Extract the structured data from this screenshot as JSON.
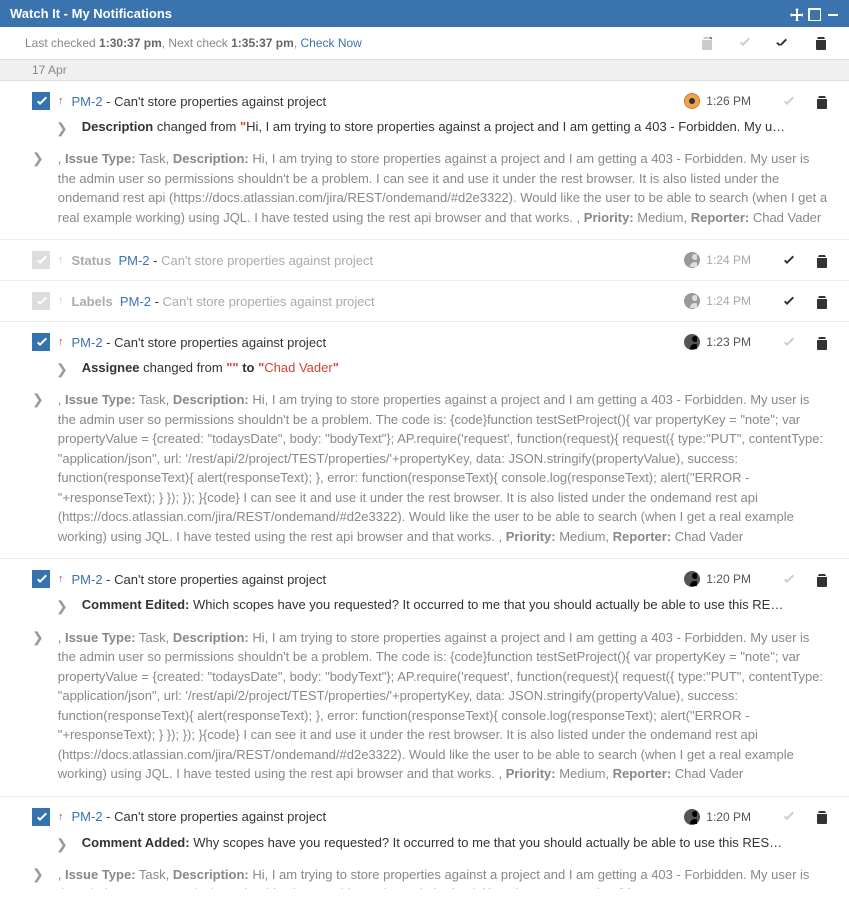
{
  "title": "Watch It - My Notifications",
  "status_prefix": "Last checked ",
  "status_last": "1:30:37 pm",
  "status_mid": ", Next check ",
  "status_next": "1:35:37 pm",
  "status_sep": ", ",
  "status_link": "Check Now",
  "date_header": "17 Apr",
  "issue_key": "PM-2",
  "issue_dash": " - ",
  "issue_summary": "Can't store properties against project",
  "labels": {
    "description": "Description",
    "status": "Status",
    "labels_label": "Labels",
    "assignee": "Assignee",
    "comment_edited": "Comment Edited:",
    "comment_added": "Comment Added:",
    "issuetype": "Issue Type:",
    "priority": "Priority:",
    "reporter": "Reporter:"
  },
  "notifications": [
    {
      "time": "1:26 PM",
      "read": false,
      "avatar": "round-orange",
      "change_pre": " changed from ",
      "change_q1": "\"",
      "change_body": "Hi, I am trying to store properties against a project and I am getting a 403 - Forbidden. My u…",
      "body_p1": ", ",
      "body_task": " Task, ",
      "body_desc_label": "Description:",
      "body_desc": " Hi, I am trying to store properties against a project and I am getting a 403 - Forbidden. My user is the admin user so permissions shouldn't be a problem.   I can see it and use it under the rest browser. It is also listed under the ondemand rest api (https://docs.atlassian.com/jira/REST/ondemand/#d2e3322). Would like the user to be able to search (when I get a real example working) using JQL. I have tested using the rest api browser and that works. , ",
      "body_priority": " Medium, ",
      "body_reporter": " Chad Vader"
    },
    {
      "time": "1:24 PM",
      "read": true,
      "avatar": "gray",
      "status_label": "Status"
    },
    {
      "time": "1:24 PM",
      "read": true,
      "avatar": "gray",
      "status_label": "Labels"
    },
    {
      "time": "1:23 PM",
      "read": false,
      "avatar": "dark",
      "change_pre": " changed from ",
      "change_q1": "\"\"",
      "change_mid": " to ",
      "change_q2": "\"",
      "change_name": "Chad Vader",
      "change_q3": "\"",
      "body_p1": ", ",
      "body_task": " Task, ",
      "body_desc_label": "Description:",
      "body_desc": " Hi, I am trying to store properties against a project and I am getting a 403 - Forbidden. My user is the admin user so permissions shouldn't be a problem. The code is: {code}function testSetProject(){ var propertyKey = \"note\"; var propertyValue = {created: \"todaysDate\", body: \"bodyText\"}; AP.require('request', function(request){ request({ type:\"PUT\", contentType: \"application/json\", url: '/rest/api/2/project/TEST/properties/'+propertyKey, data: JSON.stringify(propertyValue), success: function(responseText){ alert(responseText); }, error: function(responseText){ console.log(responseText); alert(\"ERROR - \"+responseText); } }); }); }{code} I can see it and use it under the rest browser. It is also listed under the ondemand rest api (https://docs.atlassian.com/jira/REST/ondemand/#d2e3322). Would like the user to be able to search (when I get a real example working) using JQL. I have tested using the rest api browser and that works. , ",
      "body_priority": " Medium, ",
      "body_reporter": " Chad Vader"
    },
    {
      "time": "1:20 PM",
      "read": false,
      "avatar": "dark",
      "comment": " Which scopes have you requested? It occurred to me that you should actually be able to use this RE…",
      "body_p1": ", ",
      "body_task": " Task, ",
      "body_desc_label": "Description:",
      "body_desc": " Hi, I am trying to store properties against a project and I am getting a 403 - Forbidden. My user is the admin user so permissions shouldn't be a problem. The code is: {code}function testSetProject(){ var propertyKey = \"note\"; var propertyValue = {created: \"todaysDate\", body: \"bodyText\"}; AP.require('request', function(request){ request({ type:\"PUT\", contentType: \"application/json\", url: '/rest/api/2/project/TEST/properties/'+propertyKey, data: JSON.stringify(propertyValue), success: function(responseText){ alert(responseText); }, error: function(responseText){ console.log(responseText); alert(\"ERROR - \"+responseText); } }); }); }{code} I can see it and use it under the rest browser. It is also listed under the ondemand rest api (https://docs.atlassian.com/jira/REST/ondemand/#d2e3322). Would like the user to be able to search (when I get a real example working) using JQL. I have tested using the rest api browser and that works. , ",
      "body_priority": " Medium, ",
      "body_reporter": " Chad Vader"
    },
    {
      "time": "1:20 PM",
      "read": false,
      "avatar": "dark",
      "comment": " Why scopes have you requested? It occurred to me that you should actually be able to use this RES…",
      "body_p1": ", ",
      "body_task": " Task, ",
      "body_desc_label": "Description:",
      "body_desc": " Hi, I am trying to store properties against a project and I am getting a 403 - Forbidden. My user is the admin user so permissions shouldn't be a problem. The code is: {code}function testSetProject(){ var propertyKey = "
    }
  ]
}
